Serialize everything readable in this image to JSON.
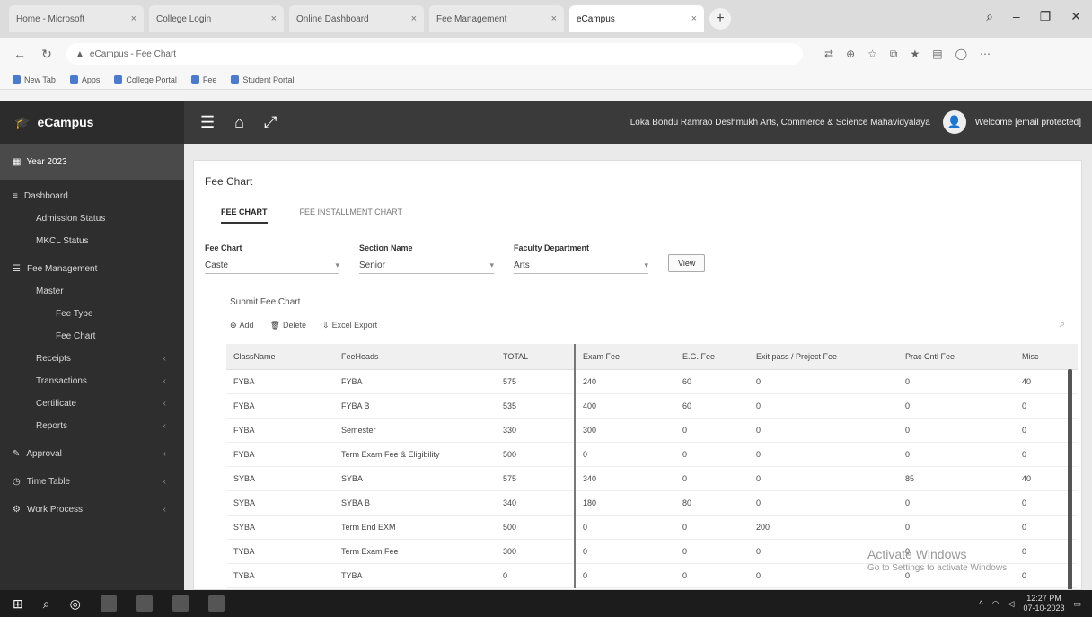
{
  "browser": {
    "tabs": [
      {
        "label": "Home - Microsoft",
        "active": false
      },
      {
        "label": "College Login",
        "active": false
      },
      {
        "label": "Online Dashboard",
        "active": false
      },
      {
        "label": "Fee Management",
        "active": false
      },
      {
        "label": "eCampus",
        "active": true
      }
    ],
    "url": "eCampus - Fee Chart",
    "bookmarks": [
      "New Tab",
      "Apps",
      "College Portal",
      "Fee",
      "Student Portal"
    ]
  },
  "header": {
    "brand": "eCampus",
    "institution": "Loka Bondu Ramrao Deshmukh Arts, Commerce & Science Mahavidyalaya",
    "user": "Welcome [email protected]"
  },
  "sidebar": {
    "year": "Year 2023",
    "items": [
      {
        "label": "Dashboard",
        "level": 0,
        "icon": "≡"
      },
      {
        "label": "Admission Status",
        "level": 1
      },
      {
        "label": "MKCL Status",
        "level": 1
      },
      {
        "label": "Fee Management",
        "level": 0,
        "icon": "☰"
      },
      {
        "label": "Master",
        "level": 1
      },
      {
        "label": "Fee Type",
        "level": 2
      },
      {
        "label": "Fee Chart",
        "level": 2
      },
      {
        "label": "Receipts",
        "level": 1,
        "chev": true
      },
      {
        "label": "Transactions",
        "level": 1,
        "chev": true
      },
      {
        "label": "Certificate",
        "level": 1,
        "chev": true
      },
      {
        "label": "Reports",
        "level": 1,
        "chev": true
      },
      {
        "label": "Approval",
        "level": 0,
        "chev": true,
        "icon": "✎"
      },
      {
        "label": "Time Table",
        "level": 0,
        "chev": true,
        "icon": "◷"
      },
      {
        "label": "Work Process",
        "level": 0,
        "chev": true,
        "icon": "⚙"
      }
    ]
  },
  "main": {
    "title": "Fee Chart",
    "subtabs": [
      "FEE CHART",
      "FEE INSTALLMENT CHART"
    ],
    "filters": [
      {
        "label": "Fee Chart",
        "value": "Caste"
      },
      {
        "label": "Section Name",
        "value": "Senior"
      },
      {
        "label": "Faculty Department",
        "value": "Arts"
      }
    ],
    "view_button": "View",
    "sublabel": "Submit Fee Chart",
    "actions": {
      "add": "Add",
      "delete": "Delete",
      "export": "Excel Export"
    },
    "table": {
      "columns": [
        "ClassName",
        "FeeHeads",
        "TOTAL",
        "Exam Fee",
        "E.G. Fee",
        "Exit pass / Project Fee",
        "Prac Cntl Fee",
        "Misc"
      ],
      "rows": [
        [
          "FYBA",
          "FYBA",
          "575",
          "240",
          "60",
          "0",
          "0",
          "40"
        ],
        [
          "FYBA",
          "FYBA B",
          "535",
          "400",
          "60",
          "0",
          "0",
          "0"
        ],
        [
          "FYBA",
          "Semester",
          "330",
          "300",
          "0",
          "0",
          "0",
          "0"
        ],
        [
          "FYBA",
          "Term Exam Fee & Eligibility",
          "500",
          "0",
          "0",
          "0",
          "0",
          "0"
        ],
        [
          "SYBA",
          "SYBA",
          "575",
          "340",
          "0",
          "0",
          "85",
          "40"
        ],
        [
          "SYBA",
          "SYBA B",
          "340",
          "180",
          "80",
          "0",
          "0",
          "0"
        ],
        [
          "SYBA",
          "Term End EXM",
          "500",
          "0",
          "0",
          "200",
          "0",
          "0"
        ],
        [
          "TYBA",
          "Term Exam Fee",
          "300",
          "0",
          "0",
          "0",
          "0",
          "0"
        ],
        [
          "TYBA",
          "TYBA",
          "0",
          "0",
          "0",
          "0",
          "0",
          "0"
        ]
      ]
    }
  },
  "watermark": {
    "line1": "Activate Windows",
    "line2": "Go to Settings to activate Windows."
  },
  "taskbar": {
    "time": "12:27 PM",
    "date": "07-10-2023"
  }
}
